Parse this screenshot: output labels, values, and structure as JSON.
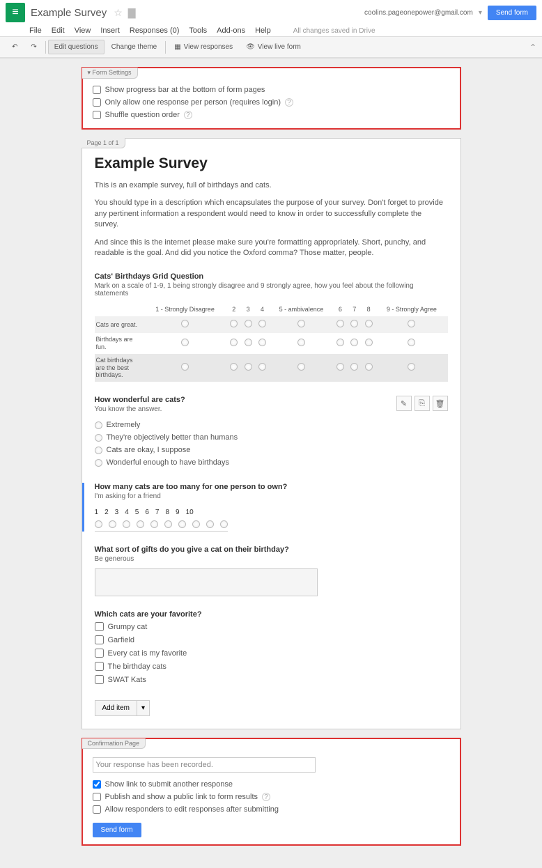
{
  "header": {
    "doc_title": "Example Survey",
    "user_email": "coolins.pageonepower@gmail.com",
    "send_button": "Send form"
  },
  "menu": {
    "file": "File",
    "edit": "Edit",
    "view": "View",
    "insert": "Insert",
    "responses": "Responses (0)",
    "tools": "Tools",
    "addons": "Add-ons",
    "help": "Help",
    "save_status": "All changes saved in Drive"
  },
  "toolbar": {
    "edit_questions": "Edit questions",
    "change_theme": "Change theme",
    "view_responses": "View responses",
    "view_live": "View live form"
  },
  "form_settings": {
    "title": "Form Settings",
    "opts": [
      "Show progress bar at the bottom of form pages",
      "Only allow one response per person (requires login)",
      "Shuffle question order"
    ]
  },
  "page_label": "Page 1 of 1",
  "form": {
    "title": "Example Survey",
    "desc1": "This is an example survey, full of birthdays and cats.",
    "desc2": "You should type in a description which encapsulates the purpose of your survey. Don't forget to provide any pertinent information a respondent would need to know in order to successfully complete the survey.",
    "desc3": "And since this is the internet please make sure you're formatting appropriately. Short, punchy, and readable is the goal. And did you notice the Oxford comma? Those matter, people."
  },
  "grid_q": {
    "title": "Cats' Birthdays Grid Question",
    "help": "Mark on a scale of 1-9, 1 being strongly disagree and 9 strongly agree, how you feel about the following statements",
    "cols": [
      "1 - Strongly Disagree",
      "2",
      "3",
      "4",
      "5 - ambivalence",
      "6",
      "7",
      "8",
      "9 - Strongly Agree"
    ],
    "rows": [
      "Cats are great.",
      "Birthdays are fun.",
      "Cat birthdays are the best birthdays."
    ]
  },
  "mc_q": {
    "title": "How wonderful are cats?",
    "help": "You know the answer.",
    "opts": [
      "Extremely",
      "They're objectively better than humans",
      "Cats are okay, I suppose",
      "Wonderful enough to have birthdays"
    ]
  },
  "scale_q": {
    "title": "How many cats are too many for one person to own?",
    "help": "I'm asking for a friend",
    "labels": [
      "1",
      "2",
      "3",
      "4",
      "5",
      "6",
      "7",
      "8",
      "9",
      "10"
    ]
  },
  "text_q": {
    "title": "What sort of gifts do you give a cat on their birthday?",
    "help": "Be generous"
  },
  "check_q": {
    "title": "Which cats are your favorite?",
    "opts": [
      "Grumpy cat",
      "Garfield",
      "Every cat is my favorite",
      "The birthday cats",
      "SWAT Kats"
    ]
  },
  "add_item": "Add item",
  "confirmation": {
    "title": "Confirmation Page",
    "message": "Your response has been recorded.",
    "opts": [
      {
        "label": "Show link to submit another response",
        "checked": true
      },
      {
        "label": "Publish and show a public link to form results",
        "checked": false,
        "help": true
      },
      {
        "label": "Allow responders to edit responses after submitting",
        "checked": false
      }
    ],
    "send": "Send form"
  }
}
